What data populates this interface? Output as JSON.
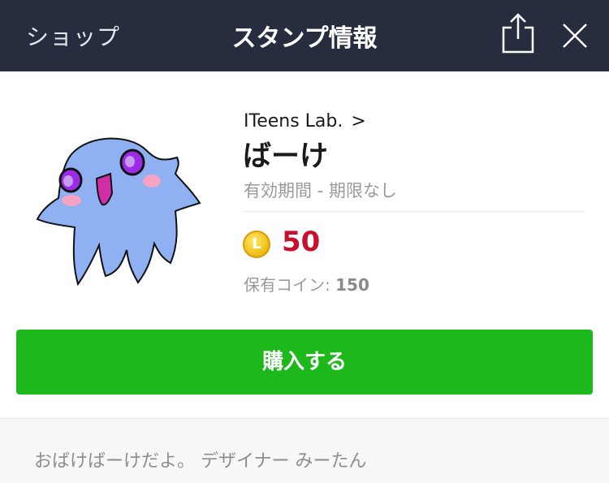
{
  "navbar": {
    "back_label": "ショップ",
    "title": "スタンプ情報",
    "share_icon": "share-icon",
    "close_icon": "close-icon"
  },
  "sticker": {
    "icon": "ghost-sticker-icon",
    "colors": {
      "body": "#8fb1f3",
      "eyes": "#9b2be6",
      "cheeks": "#f6a3c4",
      "mouth": "#d12ea6"
    }
  },
  "info": {
    "author": "ITeens Lab.",
    "author_chevron": ">",
    "name": "ばーけ",
    "validity": "有効期間 - 期限なし",
    "coin_letter": "L",
    "price": "50",
    "owned_label": "保有コイン:",
    "owned_value": "150"
  },
  "buy_button": {
    "label": "購入する",
    "color": "#1cb81c"
  },
  "description": "おばけばーけだよ。 デザイナー みーたん",
  "colors": {
    "navbar": "#262d3f",
    "price": "#c8102e",
    "button": "#1cb81c"
  }
}
